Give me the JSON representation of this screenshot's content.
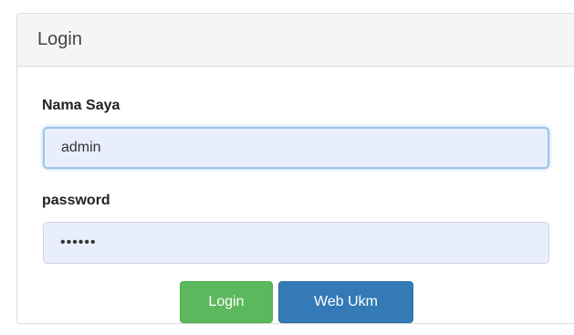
{
  "panel": {
    "title": "Login"
  },
  "form": {
    "username_label": "Nama Saya",
    "username_value": "admin",
    "password_label": "password",
    "password_value": "••••••"
  },
  "buttons": {
    "login_label": "Login",
    "webukm_label": "Web Ukm"
  },
  "colors": {
    "login_button": "#5cb85c",
    "webukm_button": "#337ab7",
    "input_background": "#e8eefc"
  }
}
